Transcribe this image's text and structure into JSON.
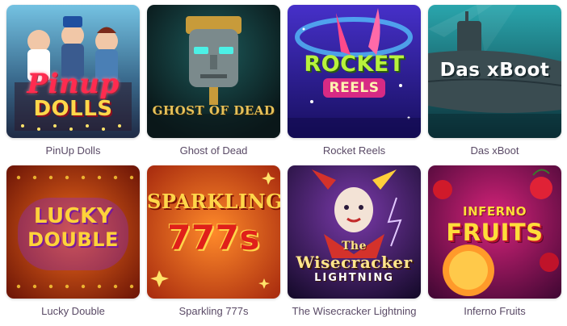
{
  "games": [
    {
      "title": "PinUp Dolls",
      "logo_line1": "Pinup",
      "logo_line2": "DOLLS",
      "theme": {
        "bg1": "#6fb6d8",
        "bg2": "#2d3a57",
        "accent": "#e8213b",
        "accent2": "#ffd34a"
      },
      "icon": "pinup-women-artwork"
    },
    {
      "title": "Ghost of Dead",
      "logo_line1": "GHOST OF DEAD",
      "theme": {
        "bg1": "#123033",
        "bg2": "#0b1719",
        "accent": "#43e0d8",
        "accent2": "#d6a83a"
      },
      "icon": "stone-mask-artwork"
    },
    {
      "title": "Rocket Reels",
      "logo_line1": "ROCKET",
      "logo_line2": "REELS",
      "theme": {
        "bg1": "#3a2db5",
        "bg2": "#1a1470",
        "accent": "#b6f23a",
        "accent2": "#ff5aa8"
      },
      "icon": "rocket-artwork"
    },
    {
      "title": "Das xBoot",
      "logo_line1": "Das xBoot",
      "theme": {
        "bg1": "#1f8f99",
        "bg2": "#0d3a44",
        "accent": "#ffffff",
        "accent2": "#2b3a3f"
      },
      "icon": "submarine-artwork"
    },
    {
      "title": "Lucky Double",
      "logo_line1": "LUCKY",
      "logo_line2": "DOUBLE",
      "theme": {
        "bg1": "#e4520f",
        "bg2": "#7a1707",
        "accent": "#ffd23a",
        "accent2": "#8a2bd0"
      },
      "icon": "lights-artwork"
    },
    {
      "title": "Sparkling 777s",
      "logo_line1": "SPARKLING",
      "logo_line2": "777s",
      "theme": {
        "bg1": "#e85a1a",
        "bg2": "#a3230c",
        "accent": "#ffd64a",
        "accent2": "#c01d12"
      },
      "icon": "sevens-artwork"
    },
    {
      "title": "The Wisecracker Lightning",
      "logo_line1": "The",
      "logo_line2": "Wisecracker",
      "logo_line3": "LIGHTNING",
      "theme": {
        "bg1": "#5a2a8a",
        "bg2": "#1b0f34",
        "accent": "#ffe58a",
        "accent2": "#d4322b"
      },
      "icon": "jester-artwork"
    },
    {
      "title": "Inferno Fruits",
      "logo_line1": "INFERNO",
      "logo_line2": "FRUITS",
      "theme": {
        "bg1": "#c6196b",
        "bg2": "#4a0a3a",
        "accent": "#ffdd3a",
        "accent2": "#ff4b2b"
      },
      "icon": "fruits-artwork"
    }
  ]
}
